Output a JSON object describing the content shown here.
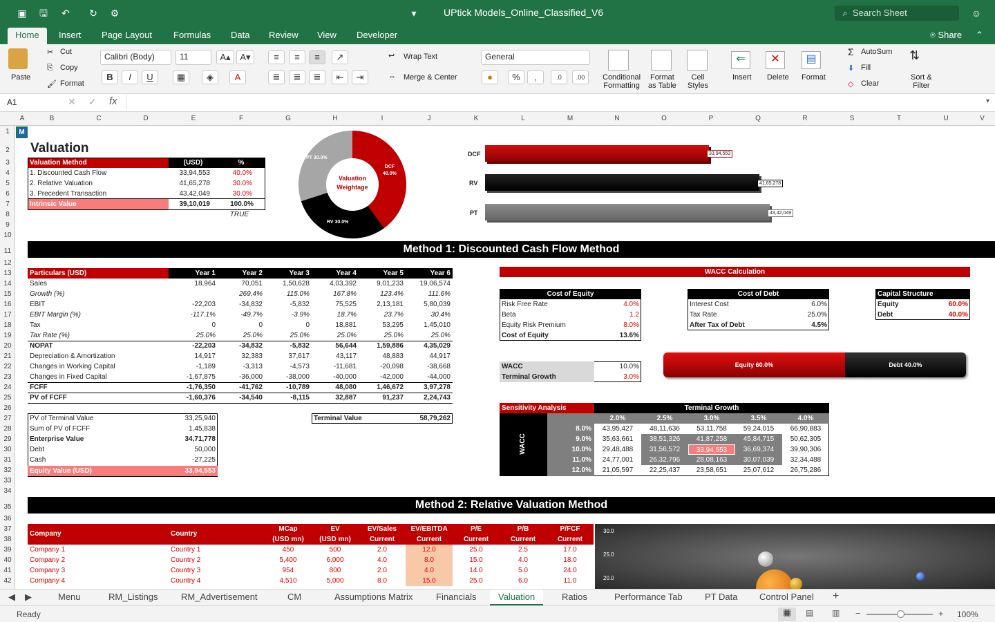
{
  "app": {
    "title": "UPtick Models_Online_Classified_V6",
    "search_placeholder": "Search Sheet",
    "share": "Share"
  },
  "ribbon_tabs": [
    "Home",
    "Insert",
    "Page Layout",
    "Formulas",
    "Data",
    "Review",
    "View",
    "Developer"
  ],
  "ribbon": {
    "paste": "Paste",
    "cut": "Cut",
    "copy": "Copy",
    "format": "Format",
    "font": "Calibri (Body)",
    "size": "11",
    "wrap": "Wrap Text",
    "merge": "Merge & Center",
    "numfmt": "General",
    "cond1": "Conditional",
    "cond2": "Formatting",
    "fat1": "Format",
    "fat2": "as Table",
    "cs1": "Cell",
    "cs2": "Styles",
    "insert": "Insert",
    "delete": "Delete",
    "formatc": "Format",
    "autosum": "AutoSum",
    "fill": "Fill",
    "clear": "Clear",
    "sort1": "Sort &",
    "sort2": "Filter"
  },
  "namebox": "A1",
  "cols": [
    "A",
    "B",
    "C",
    "D",
    "E",
    "F",
    "G",
    "H",
    "I",
    "J",
    "K",
    "L",
    "M",
    "N",
    "O",
    "P",
    "Q",
    "R",
    "S",
    "T",
    "U",
    "V"
  ],
  "rows": [
    "1",
    "2",
    "3",
    "4",
    "5",
    "6",
    "7",
    "8",
    "9",
    "10",
    "11",
    "12",
    "13",
    "14",
    "15",
    "16",
    "17",
    "18",
    "19",
    "20",
    "21",
    "22",
    "23",
    "24",
    "25",
    "26",
    "27",
    "28",
    "29",
    "30",
    "31",
    "32",
    "33",
    "34",
    "35",
    "36",
    "37",
    "38",
    "39",
    "40",
    "41",
    "42"
  ],
  "val": {
    "title": "Valuation",
    "h1": "Valuation Method",
    "h2": "(USD)",
    "h3": "%",
    "rows": [
      [
        "1. Discounted Cash Flow",
        "33,94,553",
        "40.0%"
      ],
      [
        "2. Relative Valuation",
        "41,65,278",
        "30.0%"
      ],
      [
        "3. Precedent Transaction",
        "43,42,049",
        "30.0%"
      ]
    ],
    "iv_label": "Intrinsic Value",
    "iv_val": "39,10,019",
    "iv_pct": "100.0%",
    "check": "TRUE"
  },
  "donut": {
    "center1": "Valuation",
    "center2": "Weightage",
    "dcf": "DCF",
    "dcf_p": "40.0%",
    "pt": "PT 30.0%",
    "rv": "RV 30.0%"
  },
  "bars": {
    "dcf": "DCF",
    "rv": "RV",
    "pt": "PT",
    "dcf_v": "33,94,553",
    "rv_v": "41,65,278",
    "pt_v": "43,42,049"
  },
  "band1": "Method 1: Discounted Cash Flow Method",
  "band2": "Method 2: Relative Valuation Method",
  "dcf": {
    "head": [
      "Particulars (USD)",
      "Year 1",
      "Year 2",
      "Year 3",
      "Year 4",
      "Year 5",
      "Year 6"
    ],
    "rows": [
      [
        "Sales",
        "18,964",
        "70,051",
        "1,50,628",
        "4,03,392",
        "9,01,233",
        "19,06,574"
      ],
      [
        "Growth (%)",
        "",
        "269.4%",
        "115.0%",
        "167.8%",
        "123.4%",
        "111.6%"
      ],
      [
        "EBIT",
        "-22,203",
        "-34,832",
        "-5,832",
        "75,525",
        "2,13,181",
        "5,80,039"
      ],
      [
        "EBIT Margin (%)",
        "-117.1%",
        "-49.7%",
        "-3.9%",
        "18.7%",
        "23.7%",
        "30.4%"
      ],
      [
        "Tax",
        "0",
        "0",
        "0",
        "18,881",
        "53,295",
        "1,45,010"
      ],
      [
        "Tax Rate (%)",
        "25.0%",
        "25.0%",
        "25.0%",
        "25.0%",
        "25.0%",
        "25.0%"
      ],
      [
        "NOPAT",
        "-22,203",
        "-34,832",
        "-5,832",
        "56,644",
        "1,59,886",
        "4,35,029"
      ],
      [
        "Depreciation & Amortization",
        "14,917",
        "32,383",
        "37,617",
        "43,117",
        "48,883",
        "44,917"
      ],
      [
        "Changes in Working Capital",
        "-1,189",
        "-3,313",
        "-4,573",
        "-11,681",
        "-20,098",
        "-38,668"
      ],
      [
        "Changes in Fixed Capital",
        "-1,67,875",
        "-36,000",
        "-38,000",
        "-40,000",
        "-42,000",
        "-44,000"
      ],
      [
        "FCFF",
        "-1,76,350",
        "-41,762",
        "-10,789",
        "48,080",
        "1,46,672",
        "3,97,278"
      ],
      [
        "PV of FCFF",
        "-1,60,376",
        "-34,540",
        "-8,115",
        "32,887",
        "91,237",
        "2,24,743"
      ]
    ]
  },
  "ev": {
    "rows": [
      [
        "PV of Terminal Value",
        "33,25,940"
      ],
      [
        "Sum of PV of FCFF",
        "1,45,838"
      ],
      [
        "Enterprise Value",
        "34,71,778"
      ],
      [
        "Debt",
        "50,000"
      ],
      [
        "Cash",
        "-27,225"
      ]
    ],
    "eq_label": "Equity Value (USD)",
    "eq_val": "33,94,553"
  },
  "tv": {
    "label": "Terminal Value",
    "val": "58,79,262"
  },
  "wacc": {
    "title": "WACC Calculation",
    "coe_h": "Cost of Equity",
    "coe": [
      [
        "Risk Free Rate",
        "4.0%"
      ],
      [
        "Beta",
        "1.2"
      ],
      [
        "Equity Risk Premium",
        "8.0%"
      ],
      [
        "Cost of Equity",
        "13.6%"
      ]
    ],
    "cod_h": "Cost of Debt",
    "cod": [
      [
        "Interest Cost",
        "6.0%"
      ],
      [
        "Tax Rate",
        "25.0%"
      ],
      [
        "After Tax of Debt",
        "4.5%"
      ]
    ],
    "cap_h": "Capital Structure",
    "cap": [
      [
        "Equity",
        "60.0%"
      ],
      [
        "Debt",
        "40.0%"
      ]
    ],
    "wacc_l": "WACC",
    "wacc_v": "10.0%",
    "tg_l": "Terminal Growth",
    "tg_v": "3.0%",
    "eq_bar": "Equity 60.0%",
    "debt_bar": "Debt 40.0%",
    "equity_frac": 0.6
  },
  "sens": {
    "title": "Sensitivity Analysis",
    "tg": "Terminal Growth",
    "wacc": "WACC",
    "cols": [
      "2.0%",
      "2.5%",
      "3.0%",
      "3.5%",
      "4.0%"
    ],
    "rows": [
      [
        "8.0%",
        "43,95,427",
        "48,11,636",
        "53,11,758",
        "59,24,015",
        "66,90,883"
      ],
      [
        "9.0%",
        "35,63,661",
        "38,51,326",
        "41,87,258",
        "45,84,715",
        "50,62,305"
      ],
      [
        "10.0%",
        "29,48,488",
        "31,56,572",
        "33,94,553",
        "36,69,374",
        "39,90,306"
      ],
      [
        "11.0%",
        "24,77,001",
        "26,32,796",
        "28,08,163",
        "30,07,039",
        "32,34,488"
      ],
      [
        "12.0%",
        "21,05,597",
        "22,25,437",
        "23,58,651",
        "25,07,612",
        "26,75,286"
      ]
    ]
  },
  "rel": {
    "head": [
      [
        "Company",
        ""
      ],
      [
        "Country",
        ""
      ],
      [
        "MCap",
        "(USD mn)"
      ],
      [
        "EV",
        "(USD mn)"
      ],
      [
        "EV/Sales",
        "Current"
      ],
      [
        "EV/EBITDA",
        "Current"
      ],
      [
        "P/E",
        "Current"
      ],
      [
        "P/B",
        "Current"
      ],
      [
        "P/FCF",
        "Current"
      ]
    ],
    "rows": [
      [
        "Company 1",
        "Country 1",
        "450",
        "500",
        "2.0",
        "12.0",
        "25.0",
        "2.5",
        "17.0"
      ],
      [
        "Company 2",
        "Country 2",
        "5,400",
        "6,000",
        "4.0",
        "8.0",
        "15.0",
        "4.0",
        "18.0"
      ],
      [
        "Company 3",
        "Country 3",
        "954",
        "800",
        "2.0",
        "4.0",
        "14.0",
        "5.0",
        "24.0"
      ],
      [
        "Company 4",
        "Country 4",
        "4,510",
        "5,000",
        "8.0",
        "15.0",
        "25.0",
        "6.0",
        "11.0"
      ]
    ],
    "yticks": [
      "30.0",
      "25.0",
      "20.0"
    ]
  },
  "sheet_tabs": [
    "Menu",
    "RM_Listings",
    "RM_Advertisement",
    "CM",
    "Assumptions Matrix",
    "Financials",
    "Valuation",
    "Ratios",
    "Performance Tab",
    "PT Data",
    "Control Panel"
  ],
  "status": {
    "ready": "Ready",
    "zoom": "100%"
  }
}
